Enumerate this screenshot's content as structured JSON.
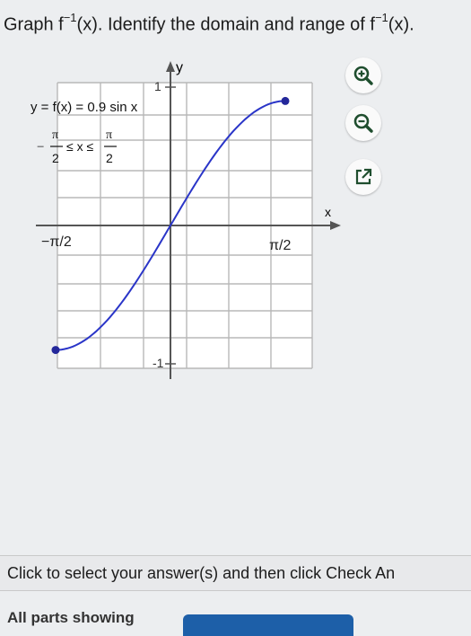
{
  "question": {
    "part1": "Graph f",
    "sup1": "−1",
    "part2": "(x). Identify the domain and range of f",
    "sup2": "−1",
    "part3": "(x)."
  },
  "graph": {
    "y_axis_label": "y",
    "x_axis_label": "x",
    "y_tick_top": "1",
    "y_tick_bottom": "-1",
    "x_tick_left": "−π/2",
    "x_tick_right": "π/2",
    "function_label": "y = f(x) = 0.9 sin x",
    "domain_left_num": "π",
    "domain_left_den": "2",
    "domain_right_num": "π",
    "domain_right_den": "2",
    "domain_middle": "≤ x ≤",
    "curve_color": "#2a35c8",
    "point_color": "#23279a"
  },
  "tools": {
    "zoom_in": "zoom-in-icon",
    "zoom_out": "zoom-out-icon",
    "popout": "popout-icon"
  },
  "instruction": "Click to select your answer(s) and then click Check An",
  "footer": {
    "parts_label": "All parts showing"
  }
}
